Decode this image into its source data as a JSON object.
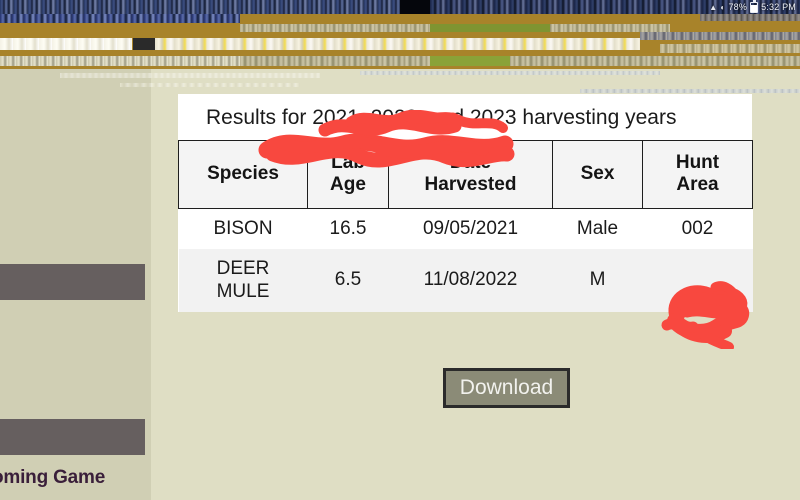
{
  "status_bar": {
    "battery_percent": "78%",
    "clock": "5:32 PM",
    "battery_icon": "battery-icon",
    "signal_icon": "signal-icon"
  },
  "sidebar": {
    "footer_text": "oming Game",
    "blocks": [
      {
        "name": "nav-block-upper"
      },
      {
        "name": "nav-block-lower"
      }
    ]
  },
  "card": {
    "title": "Results for 2021, 2022, and 2023 harvesting years",
    "table": {
      "columns": [
        "Species",
        "Lab Age",
        "Date Harvested",
        "Sex",
        "Hunt Area"
      ],
      "columns_split": [
        {
          "line1": "Species",
          "line2": ""
        },
        {
          "line1": "Lab",
          "line2": "Age"
        },
        {
          "line1": "Date",
          "line2": "Harvested"
        },
        {
          "line1": "Sex",
          "line2": ""
        },
        {
          "line1": "Hunt",
          "line2": "Area"
        }
      ],
      "rows": [
        {
          "species": "BISON",
          "lab_age": "16.5",
          "date_harvested": "09/05/2021",
          "sex": "Male",
          "hunt_area": "002",
          "hunt_area_redacted": false
        },
        {
          "species_line1": "DEER",
          "species_line2": "MULE",
          "species": "DEER MULE",
          "lab_age": "6.5",
          "date_harvested": "11/08/2022",
          "sex": "M",
          "hunt_area": "",
          "hunt_area_redacted": true
        }
      ]
    }
  },
  "actions": {
    "download_label": "Download"
  },
  "annotations": {
    "redaction_color": "#f8483f",
    "redaction_count": 2,
    "redaction_targets": [
      "title-trailing-text",
      "row-2-hunt-area"
    ]
  },
  "colors": {
    "page_background": "#dfdec4",
    "sidebar_background": "#d0cfb4",
    "sidebar_block": "#665f5f",
    "card_background": "#ffffff",
    "table_header_background": "#f4f4f4",
    "table_alt_row": "#f2f2f2",
    "button_fill": "#8b8b77",
    "button_border": "#2b2b2b",
    "footer_text_color": "#3a1f3a",
    "glitch_band": "#a8832a"
  }
}
